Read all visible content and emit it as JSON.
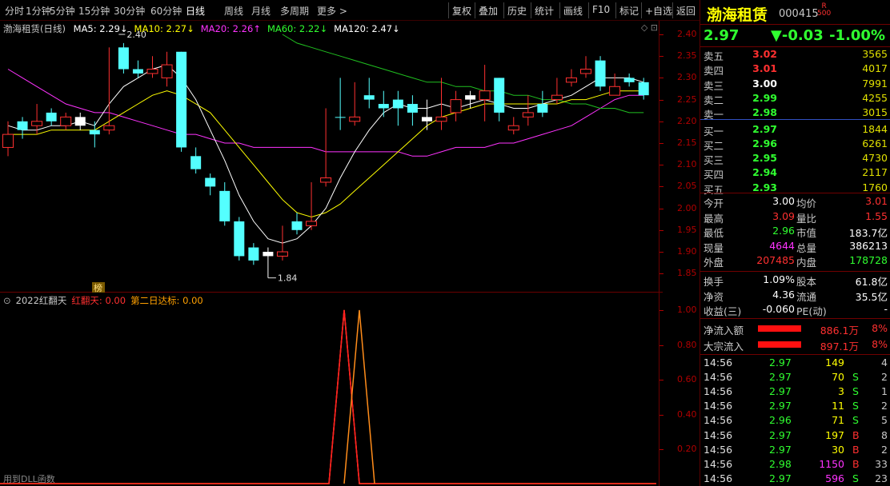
{
  "toolbar": {
    "tabs": [
      "分时",
      "1分钟",
      "5分钟",
      "15分钟",
      "30分钟",
      "60分钟",
      "日线",
      "周线",
      "月线",
      "多周期",
      "更多 >"
    ],
    "right_buttons": [
      "复权",
      "叠加",
      "历史",
      "统计",
      "画线",
      "F10",
      "标记",
      "+自选",
      "返回"
    ]
  },
  "main_chart": {
    "name": "渤海租赁(日线)",
    "ma_items": [
      "MA5: 2.29↓",
      "MA10: 2.27↓",
      "MA20: 2.26↑",
      "MA60: 2.22↓",
      "MA120: 2.47↓"
    ],
    "high_mark": "2.40",
    "low_mark": "1.84",
    "badge": "榜",
    "y_ticks": [
      "2.40",
      "2.35",
      "2.30",
      "2.25",
      "2.20",
      "2.15",
      "2.10",
      "2.05",
      "2.00",
      "1.95",
      "1.90",
      "1.85"
    ],
    "candles": [
      [
        2.17,
        2.2,
        2.14,
        2.12,
        "up"
      ],
      [
        2.2,
        2.21,
        2.18,
        2.16,
        "down"
      ],
      [
        2.2,
        2.24,
        2.19,
        2.17,
        "up"
      ],
      [
        2.22,
        2.23,
        2.2,
        2.19,
        "down"
      ],
      [
        2.21,
        2.22,
        2.19,
        2.18,
        "up"
      ],
      [
        2.21,
        2.22,
        2.19,
        2.18,
        "flat"
      ],
      [
        2.18,
        2.2,
        2.17,
        2.14,
        "down"
      ],
      [
        2.19,
        2.37,
        2.18,
        2.17,
        "up"
      ],
      [
        2.37,
        2.38,
        2.32,
        2.31,
        "down"
      ],
      [
        2.32,
        2.34,
        2.31,
        2.3,
        "down"
      ],
      [
        2.32,
        2.35,
        2.31,
        2.3,
        "up"
      ],
      [
        2.33,
        2.36,
        2.3,
        2.28,
        "up"
      ],
      [
        2.36,
        2.36,
        2.14,
        2.13,
        "down"
      ],
      [
        2.12,
        2.14,
        2.09,
        2.08,
        "down"
      ],
      [
        2.07,
        2.08,
        2.05,
        2.03,
        "down"
      ],
      [
        2.04,
        2.06,
        1.97,
        1.96,
        "down"
      ],
      [
        1.97,
        1.98,
        1.89,
        1.88,
        "down"
      ],
      [
        1.91,
        1.92,
        1.88,
        1.87,
        "down"
      ],
      [
        1.9,
        1.91,
        1.89,
        1.84,
        "flat"
      ],
      [
        1.9,
        1.96,
        1.89,
        1.88,
        "up"
      ],
      [
        1.97,
        1.99,
        1.95,
        1.94,
        "down"
      ],
      [
        1.97,
        2.06,
        1.96,
        1.95,
        "up"
      ],
      [
        2.07,
        2.23,
        2.06,
        2.05,
        "up"
      ],
      [
        2.21,
        2.3,
        2.21,
        2.18,
        "down"
      ],
      [
        2.21,
        2.29,
        2.2,
        2.19,
        "up"
      ],
      [
        2.26,
        2.3,
        2.25,
        2.23,
        "down"
      ],
      [
        2.24,
        2.27,
        2.23,
        2.21,
        "down"
      ],
      [
        2.25,
        2.27,
        2.23,
        2.19,
        "down"
      ],
      [
        2.24,
        2.26,
        2.22,
        2.19,
        "down"
      ],
      [
        2.21,
        2.25,
        2.2,
        2.18,
        "flat"
      ],
      [
        2.21,
        2.3,
        2.2,
        2.18,
        "up"
      ],
      [
        2.25,
        2.27,
        2.22,
        2.2,
        "up"
      ],
      [
        2.26,
        2.27,
        2.25,
        2.23,
        "flat"
      ],
      [
        2.27,
        2.33,
        2.25,
        2.2,
        "up"
      ],
      [
        2.3,
        2.3,
        2.22,
        2.2,
        "down"
      ],
      [
        2.19,
        2.21,
        2.18,
        2.17,
        "up"
      ],
      [
        2.22,
        2.26,
        2.21,
        2.19,
        "up"
      ],
      [
        2.24,
        2.27,
        2.22,
        2.21,
        "down"
      ],
      [
        2.26,
        2.3,
        2.25,
        2.24,
        "up"
      ],
      [
        2.3,
        2.32,
        2.29,
        2.28,
        "up"
      ],
      [
        2.32,
        2.35,
        2.31,
        2.3,
        "up"
      ],
      [
        2.34,
        2.35,
        2.28,
        2.27,
        "down"
      ],
      [
        2.28,
        2.31,
        2.26,
        2.26,
        "up"
      ],
      [
        2.3,
        2.31,
        2.29,
        2.28,
        "down"
      ],
      [
        2.29,
        2.3,
        2.26,
        2.25,
        "down"
      ]
    ],
    "ma5": [
      2.19,
      2.18,
      2.18,
      2.19,
      2.19,
      2.2,
      2.19,
      2.24,
      2.28,
      2.3,
      2.32,
      2.33,
      2.3,
      2.25,
      2.18,
      2.11,
      2.03,
      1.97,
      1.93,
      1.92,
      1.93,
      1.96,
      2.0,
      2.07,
      2.13,
      2.18,
      2.22,
      2.24,
      2.23,
      2.23,
      2.24,
      2.23,
      2.24,
      2.25,
      2.24,
      2.23,
      2.23,
      2.24,
      2.25,
      2.26,
      2.28,
      2.3,
      2.3,
      2.3,
      2.29
    ],
    "ma10": [
      2.17,
      2.17,
      2.17,
      2.18,
      2.18,
      2.18,
      2.18,
      2.2,
      2.22,
      2.24,
      2.26,
      2.27,
      2.26,
      2.24,
      2.22,
      2.18,
      2.14,
      2.1,
      2.06,
      2.02,
      1.99,
      1.98,
      1.99,
      2.01,
      2.04,
      2.07,
      2.1,
      2.13,
      2.16,
      2.19,
      2.21,
      2.22,
      2.23,
      2.24,
      2.24,
      2.24,
      2.24,
      2.24,
      2.24,
      2.25,
      2.25,
      2.26,
      2.27,
      2.27,
      2.27
    ],
    "ma20": [
      2.32,
      2.3,
      2.28,
      2.26,
      2.24,
      2.23,
      2.22,
      2.22,
      2.21,
      2.2,
      2.19,
      2.18,
      2.17,
      2.17,
      2.16,
      2.15,
      2.15,
      2.14,
      2.14,
      2.14,
      2.14,
      2.14,
      2.13,
      2.13,
      2.13,
      2.13,
      2.13,
      2.13,
      2.12,
      2.12,
      2.13,
      2.14,
      2.14,
      2.14,
      2.15,
      2.15,
      2.16,
      2.17,
      2.18,
      2.19,
      2.21,
      2.23,
      2.25,
      2.26,
      2.26
    ],
    "ma60": [
      null,
      null,
      null,
      null,
      null,
      null,
      null,
      null,
      null,
      null,
      null,
      null,
      null,
      null,
      null,
      null,
      null,
      null,
      null,
      2.4,
      2.38,
      2.37,
      2.36,
      2.35,
      2.34,
      2.33,
      2.32,
      2.31,
      2.3,
      2.29,
      2.29,
      2.28,
      2.28,
      2.27,
      2.27,
      2.26,
      2.26,
      2.25,
      2.25,
      2.24,
      2.24,
      2.23,
      2.23,
      2.22,
      2.22
    ]
  },
  "ind_chart": {
    "title": "2022红翻天",
    "label1": "红翻天: 0.00",
    "label2": "第二日达标: 0.00",
    "y_ticks": [
      "1.00",
      "0.80",
      "0.60",
      "0.40",
      "0.20"
    ],
    "footer": "用到DLL函数",
    "colors": {
      "line1": "#ff2020",
      "line2": "#ff8c1a"
    }
  },
  "quote": {
    "name": "渤海租赁",
    "code": "000415",
    "tag_r": "R",
    "tag_num": "500",
    "price": "2.97",
    "change": "▼-0.03",
    "change_pct": "-1.00%",
    "sell": [
      {
        "label": "卖五",
        "price": "3.02",
        "vol": "3565",
        "pc": "red"
      },
      {
        "label": "卖四",
        "price": "3.01",
        "vol": "4017",
        "pc": "red"
      },
      {
        "label": "卖三",
        "price": "3.00",
        "vol": "7991",
        "pc": "white"
      },
      {
        "label": "卖二",
        "price": "2.99",
        "vol": "4255",
        "pc": "green"
      },
      {
        "label": "卖一",
        "price": "2.98",
        "vol": "3015",
        "pc": "green"
      }
    ],
    "buy": [
      {
        "label": "买一",
        "price": "2.97",
        "vol": "1844",
        "pc": "green"
      },
      {
        "label": "买二",
        "price": "2.96",
        "vol": "6261",
        "pc": "green"
      },
      {
        "label": "买三",
        "price": "2.95",
        "vol": "4730",
        "pc": "green"
      },
      {
        "label": "买四",
        "price": "2.94",
        "vol": "2117",
        "pc": "green"
      },
      {
        "label": "买五",
        "price": "2.93",
        "vol": "1760",
        "pc": "green"
      }
    ],
    "stats": [
      {
        "l1": "今开",
        "v1": "3.00",
        "c1": "white",
        "l2": "均价",
        "v2": "3.01",
        "c2": "red"
      },
      {
        "l1": "最高",
        "v1": "3.09",
        "c1": "red",
        "l2": "量比",
        "v2": "1.55",
        "c2": "red"
      },
      {
        "l1": "最低",
        "v1": "2.96",
        "c1": "green",
        "l2": "市值",
        "v2": "183.7亿",
        "c2": "white"
      },
      {
        "l1": "现量",
        "v1": "4644",
        "c1": "magenta",
        "l2": "总量",
        "v2": "386213",
        "c2": "white"
      },
      {
        "l1": "外盘",
        "v1": "207485",
        "c1": "red",
        "l2": "内盘",
        "v2": "178728",
        "c2": "green"
      }
    ],
    "stats2": [
      {
        "l1": "换手",
        "v1": "1.09%",
        "l2": "股本",
        "v2": "61.8亿"
      },
      {
        "l1": "净资",
        "v1": "4.36",
        "l2": "流通",
        "v2": "35.5亿"
      },
      {
        "l1": "收益(三)",
        "v1": "-0.060",
        "l2": "PE(动)",
        "v2": "-"
      }
    ],
    "flows": [
      {
        "label": "净流入额",
        "value": "886.1万",
        "pct": "8%",
        "bar": 0.6
      },
      {
        "label": "大宗流入",
        "value": "897.1万",
        "pct": "8%",
        "bar": 0.6
      }
    ],
    "ticks": [
      {
        "t": "14:56",
        "p": "2.97",
        "v": "149",
        "vc": "yellow",
        "d": "",
        "n": "4"
      },
      {
        "t": "14:56",
        "p": "2.97",
        "v": "70",
        "vc": "yellow",
        "d": "S",
        "n": "2"
      },
      {
        "t": "14:56",
        "p": "2.97",
        "v": "3",
        "vc": "yellow",
        "d": "S",
        "n": "1"
      },
      {
        "t": "14:56",
        "p": "2.97",
        "v": "11",
        "vc": "yellow",
        "d": "S",
        "n": "2"
      },
      {
        "t": "14:56",
        "p": "2.96",
        "v": "71",
        "vc": "yellow",
        "d": "S",
        "n": "5"
      },
      {
        "t": "14:56",
        "p": "2.97",
        "v": "197",
        "vc": "yellow",
        "d": "B",
        "n": "8"
      },
      {
        "t": "14:56",
        "p": "2.97",
        "v": "30",
        "vc": "yellow",
        "d": "B",
        "n": "2"
      },
      {
        "t": "14:56",
        "p": "2.98",
        "v": "1150",
        "vc": "magenta",
        "d": "B",
        "n": "33"
      },
      {
        "t": "14:56",
        "p": "2.97",
        "v": "596",
        "vc": "magenta",
        "d": "S",
        "n": "23"
      }
    ]
  }
}
